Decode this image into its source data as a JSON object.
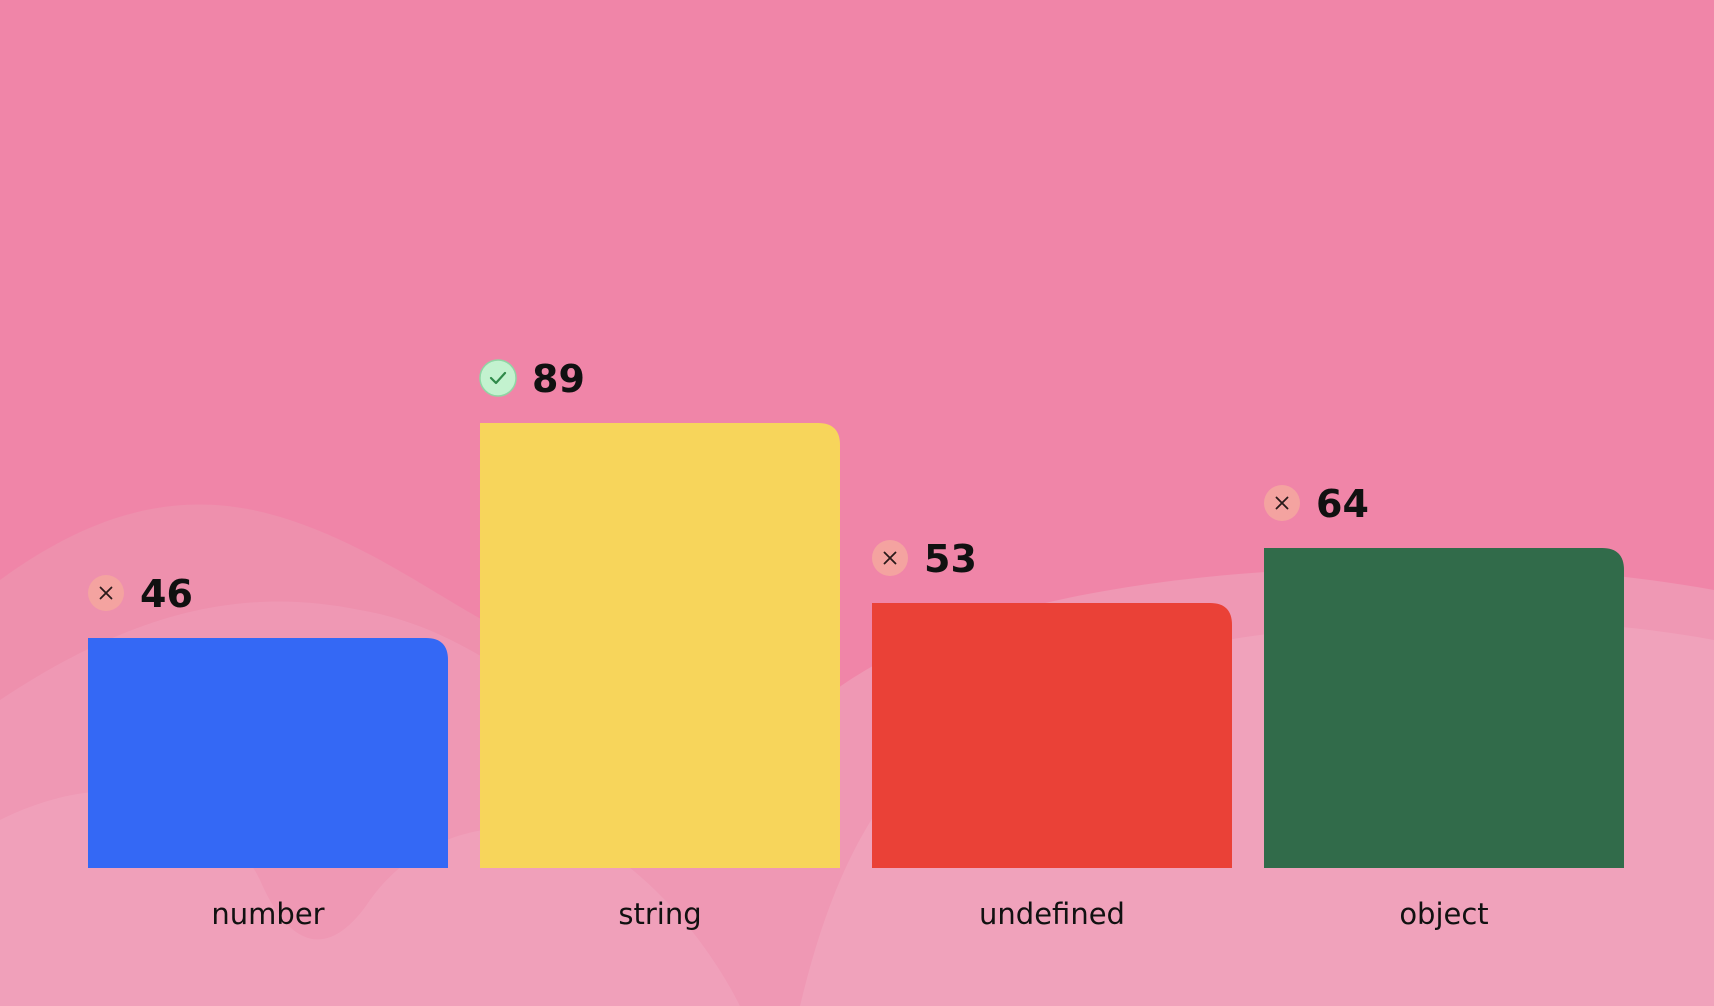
{
  "chart_data": {
    "type": "bar",
    "categories": [
      "number",
      "string",
      "undefined",
      "object"
    ],
    "values": [
      46,
      89,
      53,
      64
    ],
    "colors": [
      "#3468f5",
      "#f7d55b",
      "#ea4137",
      "#316b4a"
    ],
    "status": [
      "wrong",
      "correct",
      "wrong",
      "wrong"
    ],
    "status_icons": {
      "correct": "check-icon",
      "wrong": "close-icon"
    },
    "title": "",
    "xlabel": "",
    "ylabel": "",
    "ylim": [
      0,
      100
    ],
    "grid": false,
    "legend": "none"
  },
  "theme": {
    "background": "#f085a8",
    "label_color": "#111111",
    "correct_badge": "#c3f2cf",
    "correct_mark": "#2f8a4a",
    "wrong_badge": "#f4a3a0",
    "wrong_mark": "#2a1a1a"
  }
}
